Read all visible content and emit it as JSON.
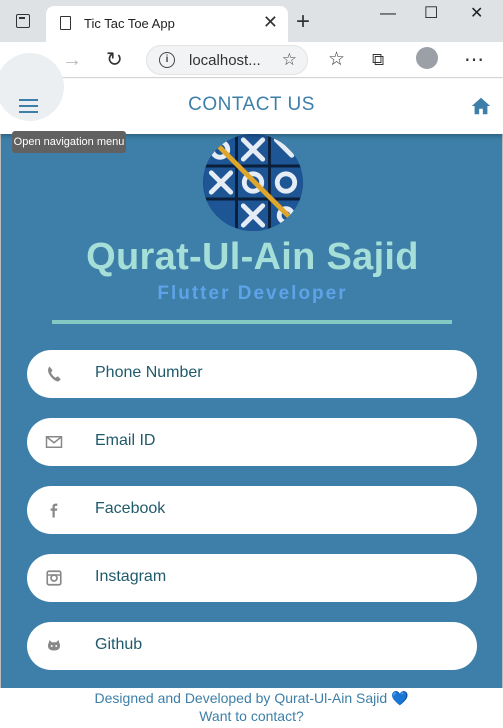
{
  "browser": {
    "tab_title": "Tic Tac Toe App",
    "address": "localhost...",
    "new_tab_symbol": "+",
    "tab_close_symbol": "✕",
    "window_controls": [
      "—",
      "☐",
      "✕"
    ]
  },
  "appbar": {
    "title": "CONTACT US",
    "menu_tooltip": "Open navigation menu",
    "accent_color": "#3d7fa8"
  },
  "profile": {
    "name": "Qurat-Ul-Ain Sajid",
    "role": "Flutter Developer"
  },
  "contacts": [
    {
      "label": "Phone Number",
      "icon": "phone-icon"
    },
    {
      "label": "Email ID",
      "icon": "mail-icon"
    },
    {
      "label": "Facebook",
      "icon": "facebook-icon"
    },
    {
      "label": "Instagram",
      "icon": "instagram-icon"
    },
    {
      "label": "Github",
      "icon": "github-icon"
    }
  ],
  "footer": {
    "credit": "Designed and Developed by Qurat-Ul-Ain Sajid 💙",
    "prompt": "Want to contact?"
  },
  "colors": {
    "background": "#3d7fa8",
    "name_color": "#a6dfd8",
    "role_color": "#5ea3e8",
    "divider": "#84c9c2"
  }
}
